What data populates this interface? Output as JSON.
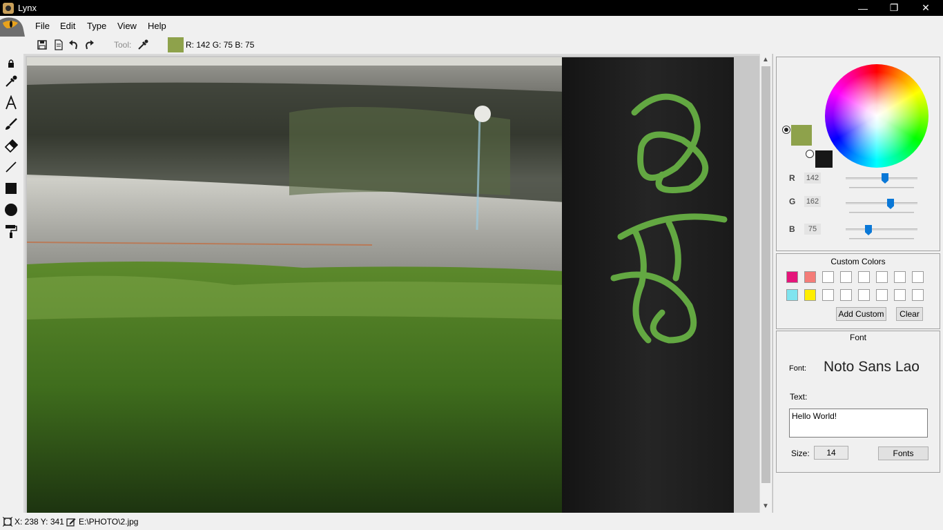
{
  "window": {
    "title": "Lynx",
    "minimize": "—",
    "restore": "❐",
    "close": "✕"
  },
  "menu": [
    "File",
    "Edit",
    "Type",
    "View",
    "Help"
  ],
  "toolbar": {
    "tool_label": "Tool:",
    "current_color": "#8ea24b",
    "rgb_readout": "R: 142 G: 75 B: 75"
  },
  "colors": {
    "primary": "#8ea24b",
    "secondary": "#171717",
    "accent": "#0a78d7"
  },
  "color_panel": {
    "r_label": "R",
    "r_value": "142",
    "g_label": "G",
    "g_value": "162",
    "b_label": "B",
    "b_value": "75"
  },
  "custom_colors": {
    "title": "Custom Colors",
    "row1": [
      "#e5157a",
      "#f47c78",
      "#ffffff",
      "#ffffff",
      "#ffffff",
      "#ffffff",
      "#ffffff",
      "#ffffff"
    ],
    "row2": [
      "#7fe4ef",
      "#ffee00",
      "#ffffff",
      "#ffffff",
      "#ffffff",
      "#ffffff",
      "#ffffff",
      "#ffffff"
    ],
    "add_label": "Add Custom",
    "clear_label": "Clear"
  },
  "font_panel": {
    "title": "Font",
    "font_label": "Font:",
    "font_name": "Noto Sans Lao",
    "text_label": "Text:",
    "text_value": "Hello World!",
    "size_label": "Size:",
    "size_value": "14",
    "fonts_button": "Fonts"
  },
  "status": {
    "coords": "X: 238 Y: 341",
    "file_path": "E:\\PHOTO\\2.jpg"
  }
}
